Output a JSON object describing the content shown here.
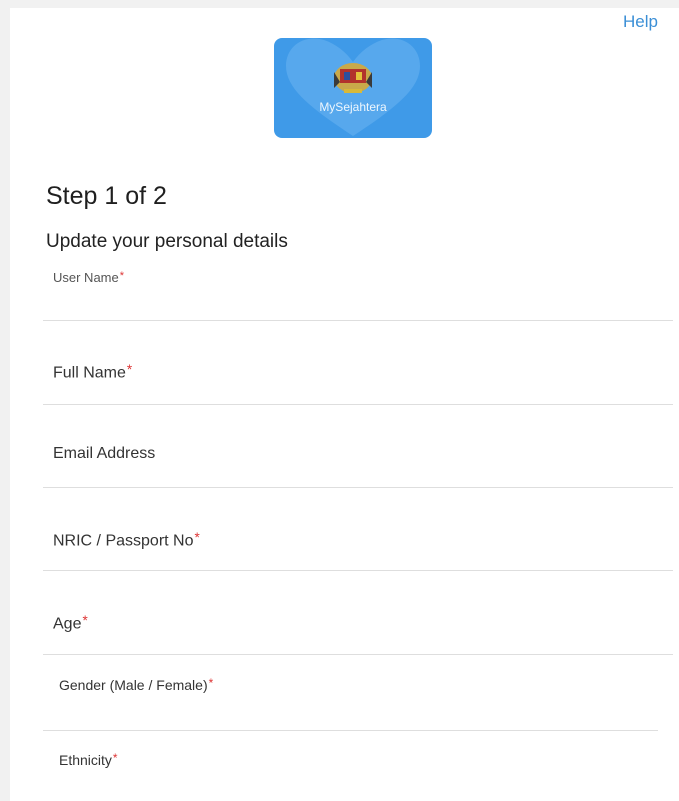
{
  "header": {
    "help_label": "Help"
  },
  "logo": {
    "text": "MySejahtera"
  },
  "form": {
    "step": "Step 1 of 2",
    "subtitle": "Update your personal details",
    "fields": [
      {
        "label": "User Name",
        "required": "*"
      },
      {
        "label": "Full Name",
        "required": "*"
      },
      {
        "label": "Email Address"
      },
      {
        "label": "NRIC / Passport No",
        "required": "*"
      },
      {
        "label": "Age",
        "required": "*"
      },
      {
        "label": "Gender (Male / Female)",
        "required": "*"
      },
      {
        "label": "Ethnicity",
        "required": "*"
      }
    ]
  },
  "colors": {
    "accent": "#3b8fd6",
    "logo_bg": "#3f9ae8",
    "required": "#dd3333"
  }
}
